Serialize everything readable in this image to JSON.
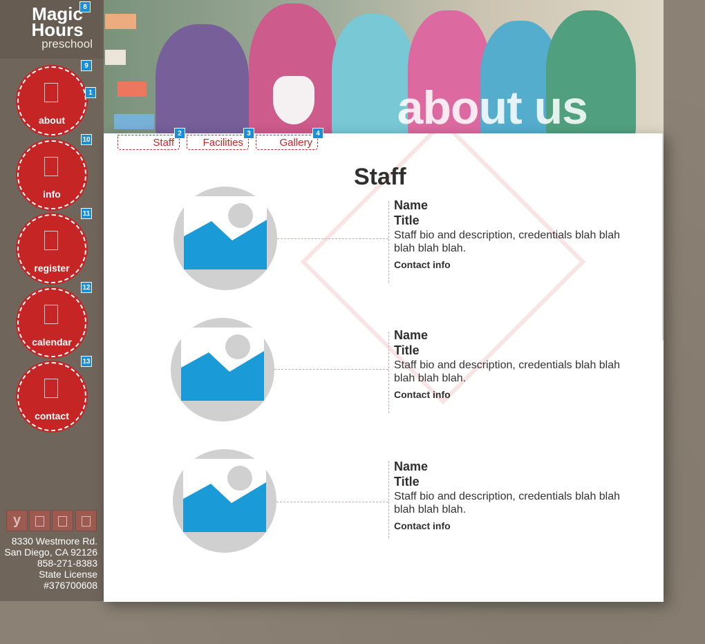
{
  "logo": {
    "line1": "Magic",
    "line2": "Hours",
    "line3": "preschool"
  },
  "nav": [
    {
      "label": "about",
      "icon": "about-icon"
    },
    {
      "label": "info",
      "icon": "info-icon"
    },
    {
      "label": "register",
      "icon": "register-icon"
    },
    {
      "label": "calendar",
      "icon": "calendar-icon"
    },
    {
      "label": "contact",
      "icon": "contact-icon"
    }
  ],
  "hero": {
    "title": "about us"
  },
  "subtabs": [
    "Staff",
    "Facilities",
    "Gallery"
  ],
  "page": {
    "title": "Staff"
  },
  "staff": [
    {
      "name": "Name",
      "title": "Title",
      "bio": "Staff bio and description, credentials blah blah blah blah blah.",
      "contact": "Contact info"
    },
    {
      "name": "Name",
      "title": "Title",
      "bio": "Staff bio and description, credentials blah blah blah blah blah.",
      "contact": "Contact info"
    },
    {
      "name": "Name",
      "title": "Title",
      "bio": "Staff bio and description, credentials blah blah blah blah blah.",
      "contact": "Contact info"
    }
  ],
  "social": [
    {
      "icon": "yelp-icon",
      "glyph": "y"
    },
    {
      "icon": "facebook-icon",
      "glyph": ""
    },
    {
      "icon": "twitter-icon",
      "glyph": ""
    },
    {
      "icon": "instagram-icon",
      "glyph": ""
    }
  ],
  "address": {
    "street": "8330 Westmore Rd.",
    "city": "San Diego, CA 92126",
    "phone": "858-271-8383",
    "license_label": "State License",
    "license_number": "#376700608"
  },
  "tags": [
    "1",
    "2",
    "3",
    "4",
    "8",
    "9",
    "10",
    "11",
    "12",
    "13"
  ],
  "colors": {
    "accent": "#c52525",
    "sidebar": "#6f655a",
    "background": "#8b8174",
    "marker": "#1a8fd6"
  }
}
